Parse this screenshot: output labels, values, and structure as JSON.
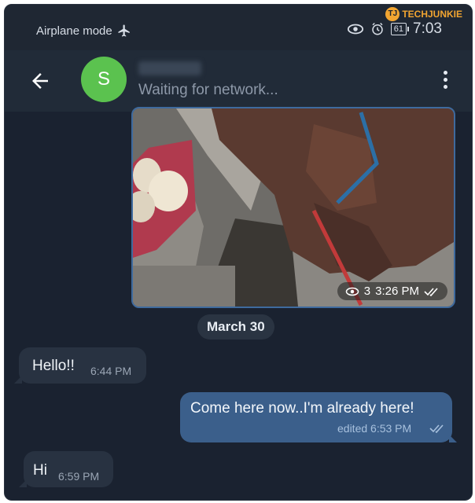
{
  "status_bar": {
    "mode_label": "Airplane mode",
    "battery_level": "61",
    "time": "7:03"
  },
  "watermark": {
    "logo_letters": "TJ",
    "text": "TECHJUNKIE"
  },
  "header": {
    "avatar_letter": "S",
    "subtitle": "Waiting for network..."
  },
  "messages": {
    "photo": {
      "views": "3",
      "time": "3:26 PM"
    },
    "date_separator": "March 30",
    "hello": {
      "text": "Hello!!",
      "time": "6:44 PM"
    },
    "outgoing": {
      "text": "Come here now..I'm already here!",
      "meta": "edited 6:53 PM"
    },
    "hi": {
      "text": "Hi",
      "time": "6:59 PM"
    }
  },
  "colors": {
    "background": "#1a2230",
    "header": "#212b38",
    "avatar": "#5bc24f",
    "outgoing_bubble": "#3b5f8b",
    "incoming_bubble": "#283241"
  }
}
